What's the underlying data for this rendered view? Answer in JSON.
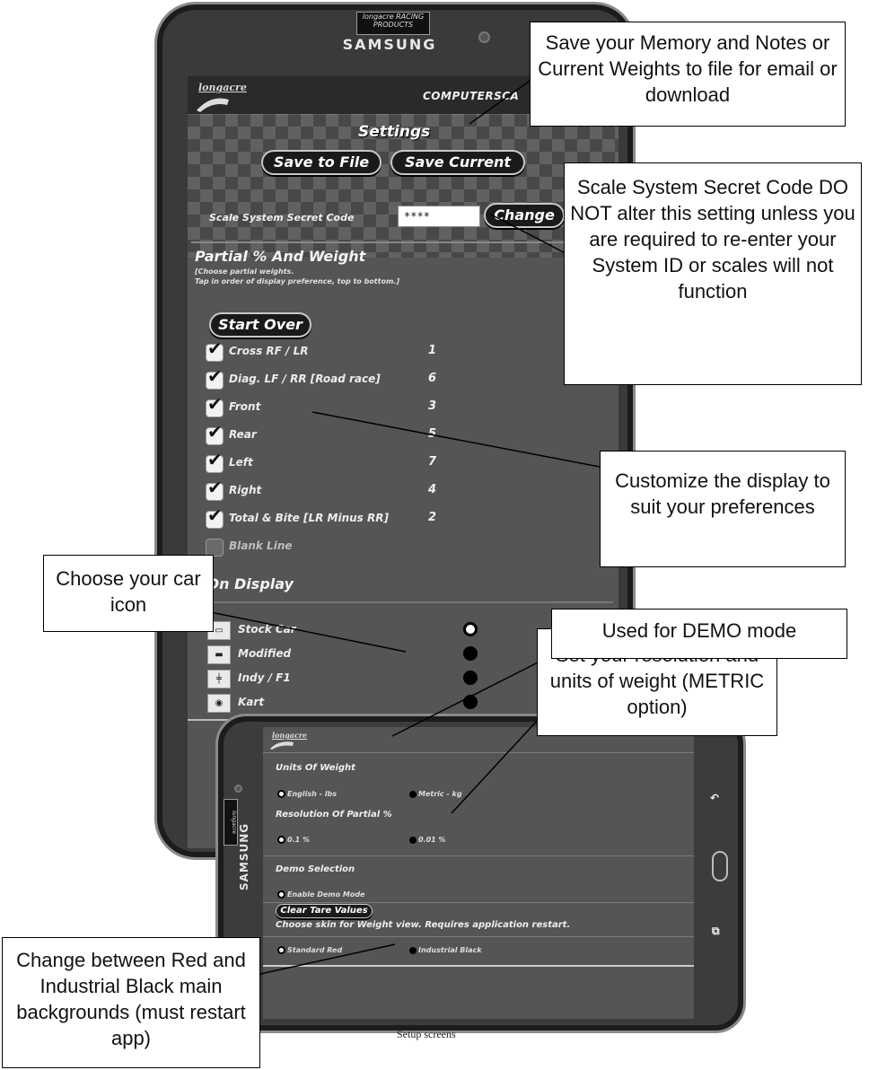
{
  "device": {
    "brand_logo": "SAMSUNG",
    "badge_text": "longacre RACING PRODUCTS"
  },
  "screen1": {
    "brand": "longacre",
    "app_title": "COMPUTERSCA",
    "title": "Settings",
    "save_to_file_label": "Save to File",
    "save_current_label": "Save Current",
    "secret_code_label": "Scale System Secret Code",
    "secret_code_value": "****",
    "change_label": "Change",
    "partial_title": "Partial % And Weight",
    "partial_hint_1": "[Choose partial weights.",
    "partial_hint_2": "Tap in order of display preference, top to bottom.]",
    "start_over_label": "Start Over",
    "partials": [
      {
        "label": "Cross RF / LR",
        "order": "1",
        "checked": true
      },
      {
        "label": "Diag. LF / RR [Road race]",
        "order": "6",
        "checked": true
      },
      {
        "label": "Front",
        "order": "3",
        "checked": true
      },
      {
        "label": "Rear",
        "order": "5",
        "checked": true
      },
      {
        "label": "Left",
        "order": "7",
        "checked": true
      },
      {
        "label": "Right",
        "order": "4",
        "checked": true
      },
      {
        "label": "Total & Bite [LR Minus RR]",
        "order": "2",
        "checked": true
      },
      {
        "label": "Blank Line",
        "order": "",
        "checked": false
      }
    ],
    "car_display_title": "r On Display",
    "cars": [
      {
        "label": "Stock Car",
        "selected": true
      },
      {
        "label": "Modified",
        "selected": false
      },
      {
        "label": "Indy / F1",
        "selected": false
      },
      {
        "label": "Kart",
        "selected": false
      }
    ],
    "bottom_partial_text": "On"
  },
  "screen2": {
    "brand": "longacre",
    "units_title": "Units Of Weight",
    "units_english": "English - lbs",
    "units_metric": "Metric - kg",
    "resolution_title": "Resolution Of Partial %",
    "res_01": "0.1 %",
    "res_001": "0.01 %",
    "demo_title": "Demo Selection",
    "demo_enable": "Enable Demo Mode",
    "clear_tare_label": "Clear Tare Values",
    "skin_title": "Choose skin for Weight view. Requires application restart.",
    "skin_red": "Standard Red",
    "skin_black": "Industrial Black"
  },
  "callouts": {
    "save": "Save your Memory and Notes or Current Weights to file for email or download",
    "secret": "Scale System Secret Code DO NOT alter this setting unless you are required to re-enter your System ID or scales will not function",
    "customize": "Customize the display to suit your preferences",
    "car_icon": "Choose your car icon",
    "resolution": "Set your resolution and units of weight (METRIC option)",
    "demo": "Used for DEMO mode",
    "background": "Change between Red and Industrial Black main backgrounds (must restart app)"
  },
  "caption": "Setup screens"
}
